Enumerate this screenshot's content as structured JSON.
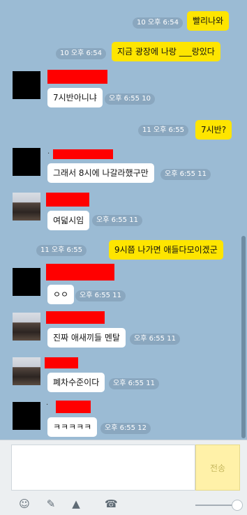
{
  "messages": [
    {
      "who": "me",
      "text": "빨리나와",
      "meta": "10 오후 6:54"
    },
    {
      "who": "me",
      "text": "지금 광장에 나랑 ___랑있다",
      "meta": "10 오후 6:54"
    },
    {
      "who": "other",
      "text": "7시반아니냐",
      "meta": "오후 6:55 10"
    },
    {
      "who": "me",
      "text": "7시반?",
      "meta": "11 오후 6:55"
    },
    {
      "who": "other",
      "text": "그래서 8시에 나갈라했구만",
      "meta": "오후 6:55 11"
    },
    {
      "who": "other",
      "text": "여덟시임",
      "meta": "오후 6:55 11"
    },
    {
      "who": "me",
      "text": "9시쯤 나가면 애들다모이겠군",
      "meta": "11 오후 6:55"
    },
    {
      "who": "other",
      "text": "ㅇㅇ",
      "meta": "오후 6:55 11"
    },
    {
      "who": "other",
      "text": "진짜 애새끼들 멘탈",
      "meta": "오후 6:55 11"
    },
    {
      "who": "other",
      "text": "폐차수준이다",
      "meta": "오후 6:55 11"
    },
    {
      "who": "other",
      "text": "ㅋㅋㅋㅋㅋ",
      "meta": "오후 6:55 12"
    }
  ],
  "composer": {
    "send_label": "전송",
    "placeholder": ""
  },
  "icons": {
    "emoji": "smile-icon",
    "attach": "paperclip-icon",
    "image": "image-icon",
    "call": "phone-icon"
  },
  "colors": {
    "chat_bg": "#9bbbd4",
    "my_bubble": "#fee500",
    "other_bubble": "#ffffff"
  }
}
